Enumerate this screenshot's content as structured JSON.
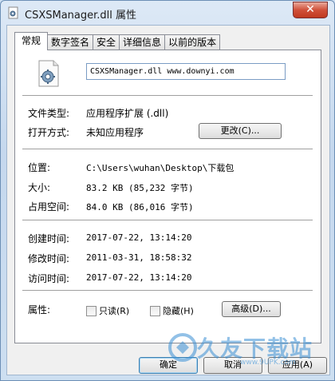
{
  "window": {
    "title": "CSXSManager.dll 属性",
    "close_glyph": "✕"
  },
  "tabs": [
    {
      "label": "常规",
      "active": true
    },
    {
      "label": "数字签名",
      "active": false
    },
    {
      "label": "安全",
      "active": false
    },
    {
      "label": "详细信息",
      "active": false
    },
    {
      "label": "以前的版本",
      "active": false
    }
  ],
  "general": {
    "file_name": "CSXSManager.dll www.downyi.com",
    "file_type_label": "文件类型:",
    "file_type_value": "应用程序扩展 (.dll)",
    "open_with_label": "打开方式:",
    "open_with_value": "未知应用程序",
    "change_button": "更改(C)...",
    "location_label": "位置:",
    "location_value": "C:\\Users\\wuhan\\Desktop\\下载包",
    "size_label": "大小:",
    "size_value": "83.2 KB (85,232 字节)",
    "size_on_disk_label": "占用空间:",
    "size_on_disk_value": "84.0 KB (86,016 字节)",
    "created_label": "创建时间:",
    "created_value": "2017-07-22, 13:14:20",
    "modified_label": "修改时间:",
    "modified_value": "2011-03-31, 18:58:32",
    "accessed_label": "访问时间:",
    "accessed_value": "2017-07-22, 13:14:20",
    "attributes_label": "属性:",
    "readonly_label": "只读(R)",
    "hidden_label": "隐藏(H)",
    "advanced_button": "高级(D)..."
  },
  "buttons": {
    "ok": "确定",
    "cancel": "取消",
    "apply": "应用(A)"
  },
  "watermark": {
    "text": "久友下载站",
    "sub": "www.9UPK.com"
  },
  "colors": {
    "accent": "#3a8fd4",
    "close": "#c0391f"
  }
}
